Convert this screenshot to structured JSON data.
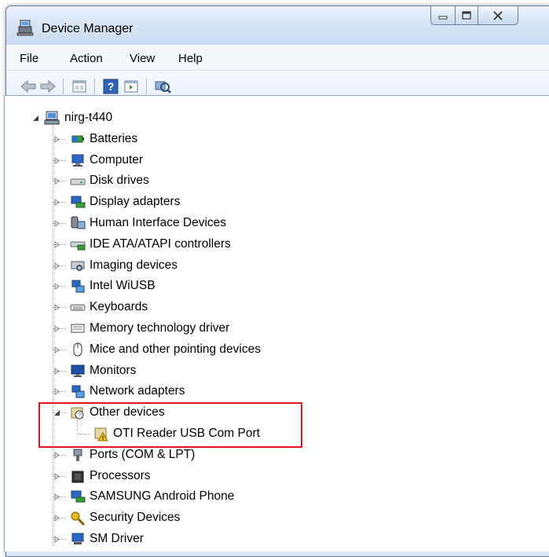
{
  "window": {
    "title": "Device Manager"
  },
  "menu": [
    "File",
    "Action",
    "View",
    "Help"
  ],
  "toolbar": [
    "back-icon",
    "forward-icon",
    "properties-icon",
    "help-icon",
    "view-icon",
    "scan-hardware-icon"
  ],
  "tree": {
    "root": "nirg-t440",
    "categories": [
      {
        "label": "Batteries",
        "icon": "battery-icon"
      },
      {
        "label": "Computer",
        "icon": "computer-icon"
      },
      {
        "label": "Disk drives",
        "icon": "disk-drive-icon"
      },
      {
        "label": "Display adapters",
        "icon": "display-adapter-icon"
      },
      {
        "label": "Human Interface Devices",
        "icon": "hid-icon"
      },
      {
        "label": "IDE ATA/ATAPI controllers",
        "icon": "ide-controller-icon"
      },
      {
        "label": "Imaging devices",
        "icon": "imaging-device-icon"
      },
      {
        "label": "Intel WiUSB",
        "icon": "network-icon"
      },
      {
        "label": "Keyboards",
        "icon": "keyboard-icon"
      },
      {
        "label": "Memory technology driver",
        "icon": "memory-icon"
      },
      {
        "label": "Mice and other pointing devices",
        "icon": "mouse-icon"
      },
      {
        "label": "Monitors",
        "icon": "monitor-icon"
      },
      {
        "label": "Network adapters",
        "icon": "network-adapter-icon"
      },
      {
        "label": "Other devices",
        "icon": "unknown-device-icon",
        "expanded": true,
        "children": [
          {
            "label": "OTI Reader USB Com Port",
            "icon": "warning-device-icon"
          }
        ]
      },
      {
        "label": "Ports (COM & LPT)",
        "icon": "port-icon"
      },
      {
        "label": "Processors",
        "icon": "processor-icon"
      },
      {
        "label": "SAMSUNG Android Phone",
        "icon": "phone-icon"
      },
      {
        "label": "Security Devices",
        "icon": "security-icon"
      },
      {
        "label": "SM Driver",
        "icon": "sm-driver-icon"
      }
    ]
  }
}
